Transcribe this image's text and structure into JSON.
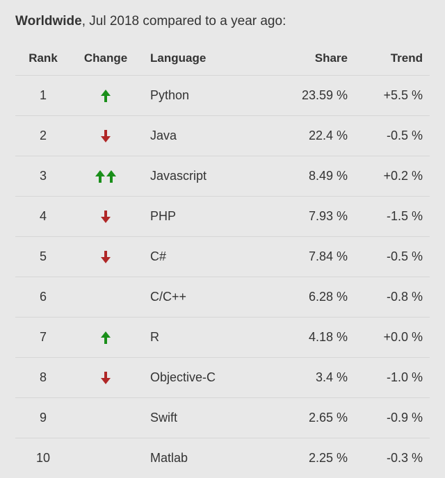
{
  "title": {
    "bold_part": "Worldwide",
    "rest": ", Jul 2018 compared to a year ago:"
  },
  "headers": {
    "rank": "Rank",
    "change": "Change",
    "language": "Language",
    "share": "Share",
    "trend": "Trend"
  },
  "colors": {
    "up": "#1a8f1a",
    "down": "#b02727"
  },
  "rows": [
    {
      "rank": "1",
      "change": "up",
      "change_count": 1,
      "language": "Python",
      "share": "23.59 %",
      "trend": "+5.5 %"
    },
    {
      "rank": "2",
      "change": "down",
      "change_count": 1,
      "language": "Java",
      "share": "22.4 %",
      "trend": "-0.5 %"
    },
    {
      "rank": "3",
      "change": "up",
      "change_count": 2,
      "language": "Javascript",
      "share": "8.49 %",
      "trend": "+0.2 %"
    },
    {
      "rank": "4",
      "change": "down",
      "change_count": 1,
      "language": "PHP",
      "share": "7.93 %",
      "trend": "-1.5 %"
    },
    {
      "rank": "5",
      "change": "down",
      "change_count": 1,
      "language": "C#",
      "share": "7.84 %",
      "trend": "-0.5 %"
    },
    {
      "rank": "6",
      "change": "none",
      "change_count": 0,
      "language": "C/C++",
      "share": "6.28 %",
      "trend": "-0.8 %"
    },
    {
      "rank": "7",
      "change": "up",
      "change_count": 1,
      "language": "R",
      "share": "4.18 %",
      "trend": "+0.0 %"
    },
    {
      "rank": "8",
      "change": "down",
      "change_count": 1,
      "language": "Objective-C",
      "share": "3.4 %",
      "trend": "-1.0 %"
    },
    {
      "rank": "9",
      "change": "none",
      "change_count": 0,
      "language": "Swift",
      "share": "2.65 %",
      "trend": "-0.9 %"
    },
    {
      "rank": "10",
      "change": "none",
      "change_count": 0,
      "language": "Matlab",
      "share": "2.25 %",
      "trend": "-0.3 %"
    }
  ],
  "chart_data": {
    "type": "table",
    "title": "Worldwide, Jul 2018 compared to a year ago",
    "columns": [
      "Rank",
      "Change",
      "Language",
      "Share",
      "Trend"
    ],
    "rows": [
      [
        1,
        "up",
        "Python",
        23.59,
        5.5
      ],
      [
        2,
        "down",
        "Java",
        22.4,
        -0.5
      ],
      [
        3,
        "up2",
        "Javascript",
        8.49,
        0.2
      ],
      [
        4,
        "down",
        "PHP",
        7.93,
        -1.5
      ],
      [
        5,
        "down",
        "C#",
        7.84,
        -0.5
      ],
      [
        6,
        "",
        "C/C++",
        6.28,
        -0.8
      ],
      [
        7,
        "up",
        "R",
        4.18,
        0.0
      ],
      [
        8,
        "down",
        "Objective-C",
        3.4,
        -1.0
      ],
      [
        9,
        "",
        "Swift",
        2.65,
        -0.9
      ],
      [
        10,
        "",
        "Matlab",
        2.25,
        -0.3
      ]
    ]
  }
}
